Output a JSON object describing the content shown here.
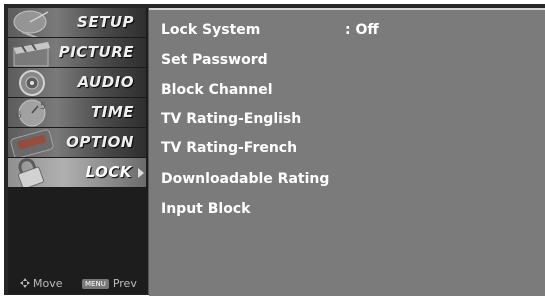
{
  "sidebar": {
    "items": [
      {
        "label": "SETUP"
      },
      {
        "label": "PICTURE"
      },
      {
        "label": "AUDIO"
      },
      {
        "label": "TIME"
      },
      {
        "label": "OPTION"
      },
      {
        "label": "LOCK"
      }
    ],
    "footer": {
      "move_label": "Move",
      "menu_key": "MENU",
      "prev_label": "Prev"
    }
  },
  "panel": {
    "options": [
      {
        "label": "Lock System",
        "value": ": Off"
      },
      {
        "label": "Set Password"
      },
      {
        "label": "Block Channel"
      },
      {
        "label": "TV Rating-English"
      },
      {
        "label": "TV Rating-French"
      },
      {
        "label": "Downloadable Rating"
      },
      {
        "label": "Input Block"
      }
    ]
  },
  "colors": {
    "panel_bg": "#7b7b7b",
    "sidebar_bg": "#1d1d1d",
    "text": "#ffffff"
  },
  "icons": [
    "satellite-dish-icon",
    "clapper-icon",
    "speaker-icon",
    "clock-icon",
    "option-icon",
    "padlock-icon",
    "move-arrows-icon",
    "right-arrow-icon"
  ]
}
